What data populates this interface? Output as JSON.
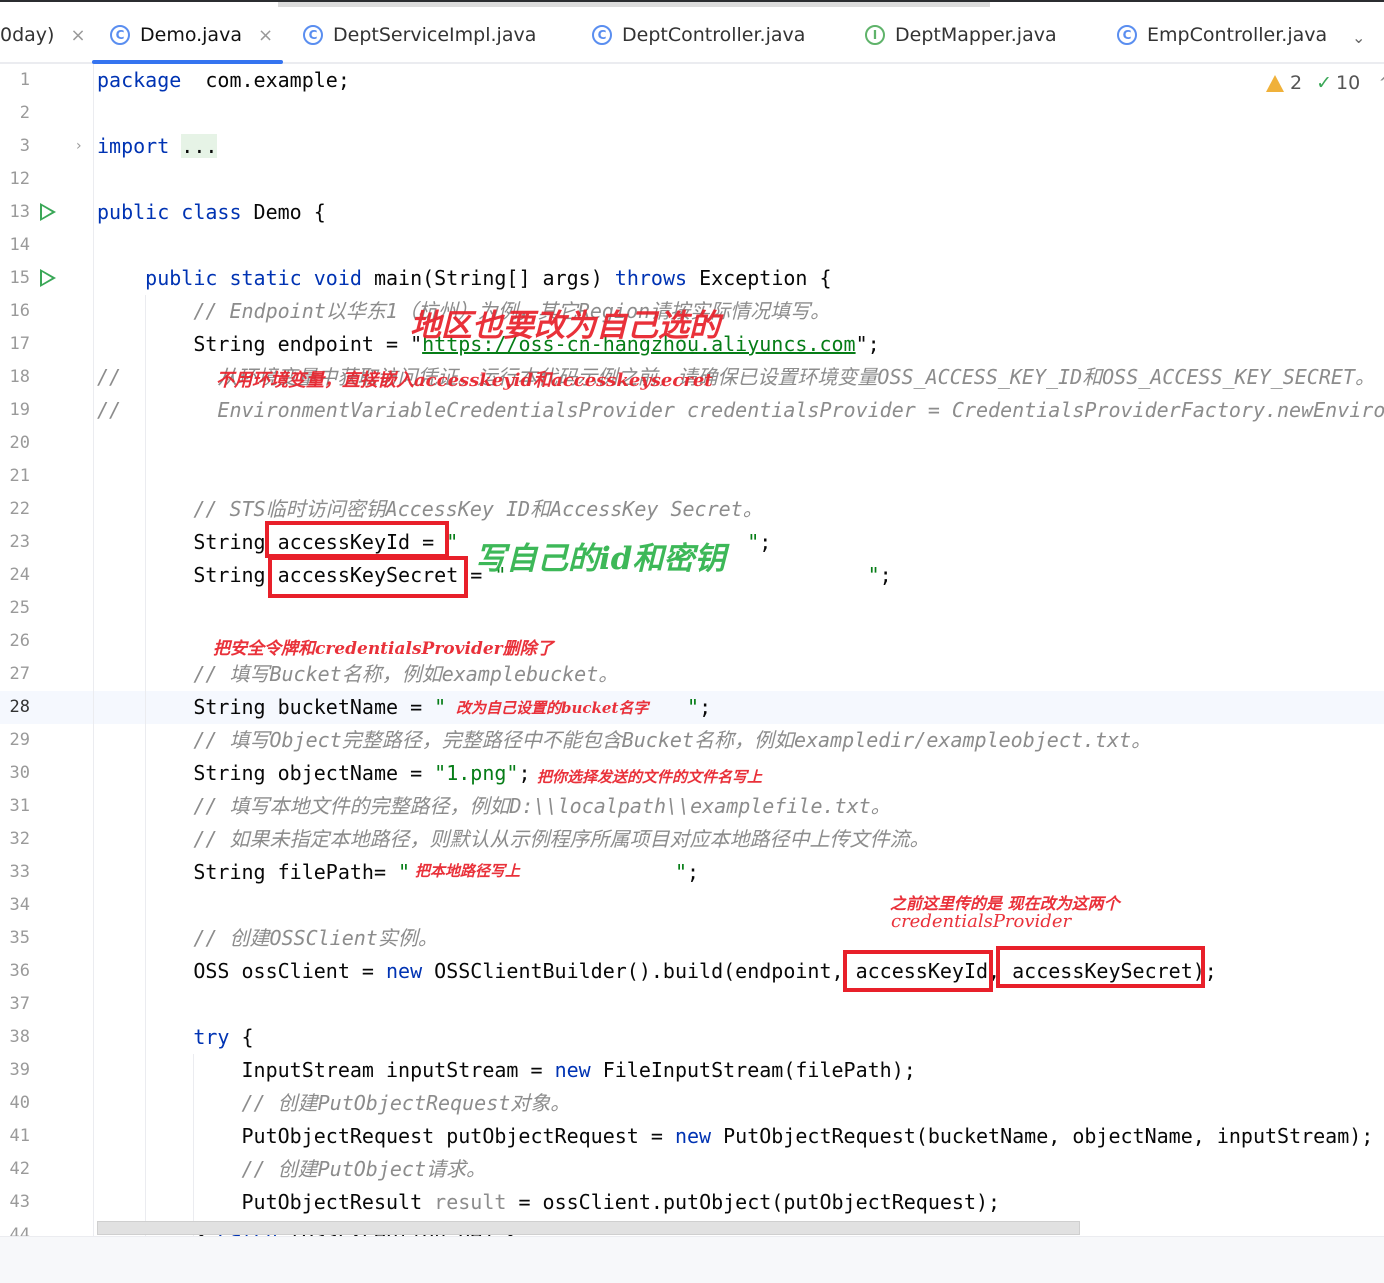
{
  "tabs": [
    {
      "label": "0day)",
      "icon": "none",
      "closable": true
    },
    {
      "label": "Demo.java",
      "icon": "class-icon",
      "closable": true,
      "active": true
    },
    {
      "label": "DeptServiceImpl.java",
      "icon": "class-icon"
    },
    {
      "label": "DeptController.java",
      "icon": "class-icon"
    },
    {
      "label": "DeptMapper.java",
      "icon": "interface-icon"
    },
    {
      "label": "EmpController.java",
      "icon": "class-icon"
    }
  ],
  "inspections": {
    "warnings": "2",
    "ok": "10"
  },
  "icons": {
    "class": "C",
    "interface": "I",
    "close": "×",
    "chevron": "⌄",
    "fold": "›"
  },
  "current_line": "28",
  "lines": [
    {
      "n": "1",
      "t": [
        [
          "kw",
          "package"
        ],
        [
          "",
          "  com.example;"
        ]
      ]
    },
    {
      "n": "2",
      "t": []
    },
    {
      "n": "3",
      "fold": true,
      "t": [
        [
          "kw",
          "import"
        ],
        [
          "",
          " "
        ],
        [
          "fd",
          "..."
        ]
      ]
    },
    {
      "n": "12",
      "t": []
    },
    {
      "n": "13",
      "run": true,
      "t": [
        [
          "kw",
          "public class"
        ],
        [
          "",
          " Demo {"
        ]
      ]
    },
    {
      "n": "14",
      "t": []
    },
    {
      "n": "15",
      "run": true,
      "t": [
        [
          "",
          "    "
        ],
        [
          "kw",
          "public static void"
        ],
        [
          "",
          " main(String[] args) "
        ],
        [
          "kw",
          "throws"
        ],
        [
          "",
          " Exception {"
        ]
      ]
    },
    {
      "n": "16",
      "t": [
        [
          "",
          "        "
        ],
        [
          "cm",
          "// Endpoint以华东1（杭州）为例，其它Region请按实际情况填写。"
        ]
      ]
    },
    {
      "n": "17",
      "t": [
        [
          "",
          "        String endpoint = \""
        ],
        [
          "url",
          "https://oss-cn-hangzhou.aliyuncs.com"
        ],
        [
          "",
          "\";"
        ]
      ]
    },
    {
      "n": "18",
      "t": [
        [
          "cm",
          "//        从环境变量中获取访问凭证。运行本代码示例之前，请确保已设置环境变量OSS_ACCESS_KEY_ID和OSS_ACCESS_KEY_SECRET。"
        ]
      ]
    },
    {
      "n": "19",
      "t": [
        [
          "cm",
          "//        EnvironmentVariableCredentialsProvider credentialsProvider = CredentialsProviderFactory.newEnvironmentVariableCredentialsProvider();"
        ]
      ]
    },
    {
      "n": "20",
      "t": []
    },
    {
      "n": "21",
      "t": []
    },
    {
      "n": "22",
      "t": [
        [
          "",
          "        "
        ],
        [
          "cm",
          "// STS临时访问密钥AccessKey ID和AccessKey Secret。"
        ]
      ]
    },
    {
      "n": "23",
      "t": [
        [
          "",
          "        String accessKeyId = "
        ],
        [
          "str",
          "\"                        \""
        ],
        [
          "",
          ";"
        ]
      ]
    },
    {
      "n": "24",
      "t": [
        [
          "",
          "        String accessKeySecret = "
        ],
        [
          "str",
          "\"                              \""
        ],
        [
          "",
          ";"
        ]
      ]
    },
    {
      "n": "25",
      "t": []
    },
    {
      "n": "26",
      "t": []
    },
    {
      "n": "27",
      "t": [
        [
          "",
          "        "
        ],
        [
          "cm",
          "// 填写Bucket名称，例如examplebucket。"
        ]
      ]
    },
    {
      "n": "28",
      "t": [
        [
          "",
          "        String bucketName = "
        ],
        [
          "str",
          "\"                    \""
        ],
        [
          "",
          ";"
        ]
      ]
    },
    {
      "n": "29",
      "t": [
        [
          "",
          "        "
        ],
        [
          "cm",
          "// 填写Object完整路径，完整路径中不能包含Bucket名称，例如exampledir/exampleobject.txt。"
        ]
      ]
    },
    {
      "n": "30",
      "t": [
        [
          "",
          "        String objectName = "
        ],
        [
          "str",
          "\"1.png\""
        ],
        [
          "",
          ";"
        ]
      ]
    },
    {
      "n": "31",
      "t": [
        [
          "",
          "        "
        ],
        [
          "cm",
          "// 填写本地文件的完整路径，例如D:\\\\localpath\\\\examplefile.txt。"
        ]
      ]
    },
    {
      "n": "32",
      "t": [
        [
          "",
          "        "
        ],
        [
          "cm",
          "// 如果未指定本地路径，则默认从示例程序所属项目对应本地路径中上传文件流。"
        ]
      ]
    },
    {
      "n": "33",
      "t": [
        [
          "",
          "        String filePath= "
        ],
        [
          "str",
          "\"                      \""
        ],
        [
          "",
          ";"
        ]
      ]
    },
    {
      "n": "34",
      "t": []
    },
    {
      "n": "35",
      "t": [
        [
          "",
          "        "
        ],
        [
          "cm",
          "// 创建OSSClient实例。"
        ]
      ]
    },
    {
      "n": "36",
      "t": [
        [
          "",
          "        OSS ossClient = "
        ],
        [
          "kw",
          "new"
        ],
        [
          "",
          " OSSClientBuilder().build(endpoint, accessKeyId, accessKeySecret);"
        ]
      ]
    },
    {
      "n": "37",
      "t": []
    },
    {
      "n": "38",
      "t": [
        [
          "",
          "        "
        ],
        [
          "kw",
          "try"
        ],
        [
          "",
          " {"
        ]
      ]
    },
    {
      "n": "39",
      "t": [
        [
          "",
          "            InputStream inputStream = "
        ],
        [
          "kw",
          "new"
        ],
        [
          "",
          " FileInputStream(filePath);"
        ]
      ]
    },
    {
      "n": "40",
      "t": [
        [
          "",
          "            "
        ],
        [
          "cm",
          "// 创建PutObjectRequest对象。"
        ]
      ]
    },
    {
      "n": "41",
      "t": [
        [
          "",
          "            PutObjectRequest putObjectRequest = "
        ],
        [
          "kw",
          "new"
        ],
        [
          "",
          " PutObjectRequest(bucketName, objectName, inputStream);"
        ]
      ]
    },
    {
      "n": "42",
      "t": [
        [
          "",
          "            "
        ],
        [
          "cm",
          "// 创建PutObject请求。"
        ]
      ]
    },
    {
      "n": "43",
      "t": [
        [
          "",
          "            PutObjectResult "
        ],
        [
          "gr",
          "result"
        ],
        [
          "",
          " = ossClient.putObject(putObjectRequest);"
        ]
      ]
    },
    {
      "n": "44",
      "t": [
        [
          "",
          "        } "
        ],
        [
          "kw",
          "catch"
        ],
        [
          "",
          " (OSSException oe) {"
        ]
      ]
    }
  ],
  "annotations": {
    "region": "地区也要改为自己选的",
    "no_env": "不用环境变量，直接嵌入accesskeyid和accesskeysecret",
    "own_keys": "写自己的id和密钥",
    "removed": "把安全令牌和credentialsProvider删除了",
    "bucket": "改为自己设置的bucket名字",
    "filename": "把你选择发送的文件的文件名写上",
    "path": "把本地路径写上",
    "before_1": "之前这里传的是  现在改为这两个",
    "before_2": "credentialsProvider"
  },
  "colors": {
    "annotation_red": "#e8202a",
    "annotation_green": "#2db34a",
    "keyword": "#0033b3",
    "string": "#067d17",
    "comment": "#8c8c8c",
    "accent": "#3574f0"
  }
}
